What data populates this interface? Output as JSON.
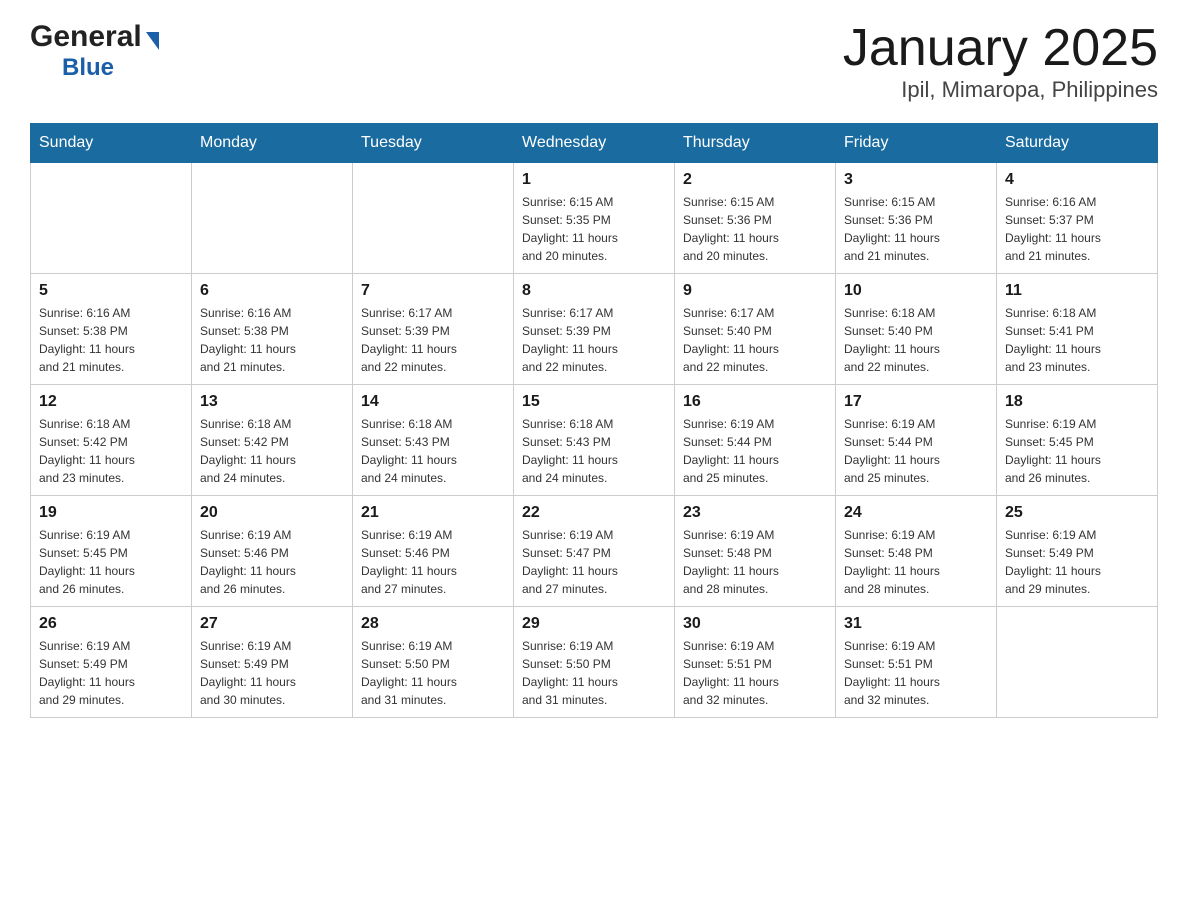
{
  "header": {
    "logo_general": "General",
    "logo_blue": "Blue",
    "month_title": "January 2025",
    "location": "Ipil, Mimaropa, Philippines"
  },
  "days_of_week": [
    "Sunday",
    "Monday",
    "Tuesday",
    "Wednesday",
    "Thursday",
    "Friday",
    "Saturday"
  ],
  "weeks": [
    [
      {
        "day": "",
        "info": ""
      },
      {
        "day": "",
        "info": ""
      },
      {
        "day": "",
        "info": ""
      },
      {
        "day": "1",
        "info": "Sunrise: 6:15 AM\nSunset: 5:35 PM\nDaylight: 11 hours\nand 20 minutes."
      },
      {
        "day": "2",
        "info": "Sunrise: 6:15 AM\nSunset: 5:36 PM\nDaylight: 11 hours\nand 20 minutes."
      },
      {
        "day": "3",
        "info": "Sunrise: 6:15 AM\nSunset: 5:36 PM\nDaylight: 11 hours\nand 21 minutes."
      },
      {
        "day": "4",
        "info": "Sunrise: 6:16 AM\nSunset: 5:37 PM\nDaylight: 11 hours\nand 21 minutes."
      }
    ],
    [
      {
        "day": "5",
        "info": "Sunrise: 6:16 AM\nSunset: 5:38 PM\nDaylight: 11 hours\nand 21 minutes."
      },
      {
        "day": "6",
        "info": "Sunrise: 6:16 AM\nSunset: 5:38 PM\nDaylight: 11 hours\nand 21 minutes."
      },
      {
        "day": "7",
        "info": "Sunrise: 6:17 AM\nSunset: 5:39 PM\nDaylight: 11 hours\nand 22 minutes."
      },
      {
        "day": "8",
        "info": "Sunrise: 6:17 AM\nSunset: 5:39 PM\nDaylight: 11 hours\nand 22 minutes."
      },
      {
        "day": "9",
        "info": "Sunrise: 6:17 AM\nSunset: 5:40 PM\nDaylight: 11 hours\nand 22 minutes."
      },
      {
        "day": "10",
        "info": "Sunrise: 6:18 AM\nSunset: 5:40 PM\nDaylight: 11 hours\nand 22 minutes."
      },
      {
        "day": "11",
        "info": "Sunrise: 6:18 AM\nSunset: 5:41 PM\nDaylight: 11 hours\nand 23 minutes."
      }
    ],
    [
      {
        "day": "12",
        "info": "Sunrise: 6:18 AM\nSunset: 5:42 PM\nDaylight: 11 hours\nand 23 minutes."
      },
      {
        "day": "13",
        "info": "Sunrise: 6:18 AM\nSunset: 5:42 PM\nDaylight: 11 hours\nand 24 minutes."
      },
      {
        "day": "14",
        "info": "Sunrise: 6:18 AM\nSunset: 5:43 PM\nDaylight: 11 hours\nand 24 minutes."
      },
      {
        "day": "15",
        "info": "Sunrise: 6:18 AM\nSunset: 5:43 PM\nDaylight: 11 hours\nand 24 minutes."
      },
      {
        "day": "16",
        "info": "Sunrise: 6:19 AM\nSunset: 5:44 PM\nDaylight: 11 hours\nand 25 minutes."
      },
      {
        "day": "17",
        "info": "Sunrise: 6:19 AM\nSunset: 5:44 PM\nDaylight: 11 hours\nand 25 minutes."
      },
      {
        "day": "18",
        "info": "Sunrise: 6:19 AM\nSunset: 5:45 PM\nDaylight: 11 hours\nand 26 minutes."
      }
    ],
    [
      {
        "day": "19",
        "info": "Sunrise: 6:19 AM\nSunset: 5:45 PM\nDaylight: 11 hours\nand 26 minutes."
      },
      {
        "day": "20",
        "info": "Sunrise: 6:19 AM\nSunset: 5:46 PM\nDaylight: 11 hours\nand 26 minutes."
      },
      {
        "day": "21",
        "info": "Sunrise: 6:19 AM\nSunset: 5:46 PM\nDaylight: 11 hours\nand 27 minutes."
      },
      {
        "day": "22",
        "info": "Sunrise: 6:19 AM\nSunset: 5:47 PM\nDaylight: 11 hours\nand 27 minutes."
      },
      {
        "day": "23",
        "info": "Sunrise: 6:19 AM\nSunset: 5:48 PM\nDaylight: 11 hours\nand 28 minutes."
      },
      {
        "day": "24",
        "info": "Sunrise: 6:19 AM\nSunset: 5:48 PM\nDaylight: 11 hours\nand 28 minutes."
      },
      {
        "day": "25",
        "info": "Sunrise: 6:19 AM\nSunset: 5:49 PM\nDaylight: 11 hours\nand 29 minutes."
      }
    ],
    [
      {
        "day": "26",
        "info": "Sunrise: 6:19 AM\nSunset: 5:49 PM\nDaylight: 11 hours\nand 29 minutes."
      },
      {
        "day": "27",
        "info": "Sunrise: 6:19 AM\nSunset: 5:49 PM\nDaylight: 11 hours\nand 30 minutes."
      },
      {
        "day": "28",
        "info": "Sunrise: 6:19 AM\nSunset: 5:50 PM\nDaylight: 11 hours\nand 31 minutes."
      },
      {
        "day": "29",
        "info": "Sunrise: 6:19 AM\nSunset: 5:50 PM\nDaylight: 11 hours\nand 31 minutes."
      },
      {
        "day": "30",
        "info": "Sunrise: 6:19 AM\nSunset: 5:51 PM\nDaylight: 11 hours\nand 32 minutes."
      },
      {
        "day": "31",
        "info": "Sunrise: 6:19 AM\nSunset: 5:51 PM\nDaylight: 11 hours\nand 32 minutes."
      },
      {
        "day": "",
        "info": ""
      }
    ]
  ]
}
